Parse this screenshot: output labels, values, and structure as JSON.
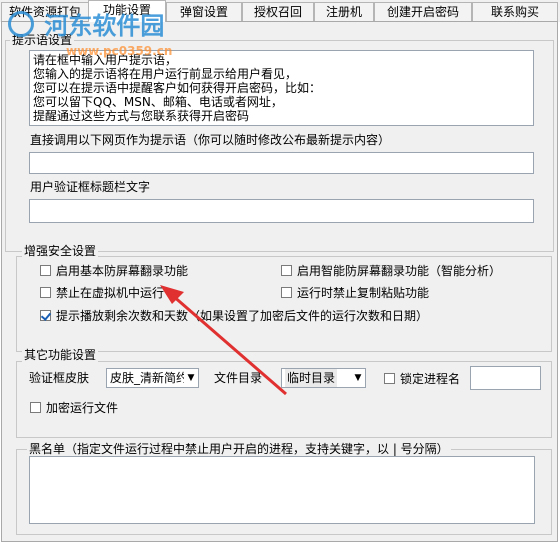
{
  "tabs": [
    {
      "label": "软件资源打包"
    },
    {
      "label": "功能设置"
    },
    {
      "label": "弹窗设置"
    },
    {
      "label": "授权召回"
    },
    {
      "label": "注册机"
    },
    {
      "label": "创建开启密码"
    },
    {
      "label": "联系购买"
    }
  ],
  "prompt_group": {
    "title": "提示语设置",
    "text": "请在框中输入用户提示语，\n您输入的提示语将在用户运行前显示给用户看见，\n您可以在提示语中提醒客户如何获得开启密码，比如：\n您可以留下QQ、MSN、邮箱、电话或者网址，\n提醒通过这些方式与您联系获得开启密码",
    "web_label": "直接调用以下网页作为提示语（你可以随时修改公布最新提示内容）",
    "web_value": "",
    "title_label": "用户验证框标题栏文字",
    "title_value": ""
  },
  "security_group": {
    "title": "增强安全设置",
    "opt_basic_anti_capture": {
      "label": "启用基本防屏幕翻录功能",
      "checked": false
    },
    "opt_smart_anti_capture": {
      "label": "启用智能防屏幕翻录功能（智能分析）",
      "checked": false
    },
    "opt_no_vm": {
      "label": "禁止在虚拟机中运行",
      "checked": false
    },
    "opt_no_clipboard": {
      "label": "运行时禁止复制粘贴功能",
      "checked": false
    },
    "opt_remaining": {
      "label": "提示播放剩余次数和天数（如果设置了加密后文件的运行次数和日期）",
      "checked": true
    }
  },
  "other_group": {
    "title": "其它功能设置",
    "skin_label": "验证框皮肤",
    "skin_value": "皮肤_清新简约",
    "dir_label": "文件目录",
    "dir_value": "临时目录",
    "lock_process_label": "锁定进程名",
    "lock_process_value": "",
    "encrypt_run_label": "加密运行文件"
  },
  "blacklist_group": {
    "title": "黑名单（指定文件运行过程中禁止用户开启的进程，支持关键字，以 | 号分隔）",
    "value": ""
  },
  "watermark": {
    "text": "河东软件园",
    "url": "www.pc0359.cn"
  },
  "colors": {
    "accent": "#1a5fb4",
    "arrow": "#e03030"
  }
}
